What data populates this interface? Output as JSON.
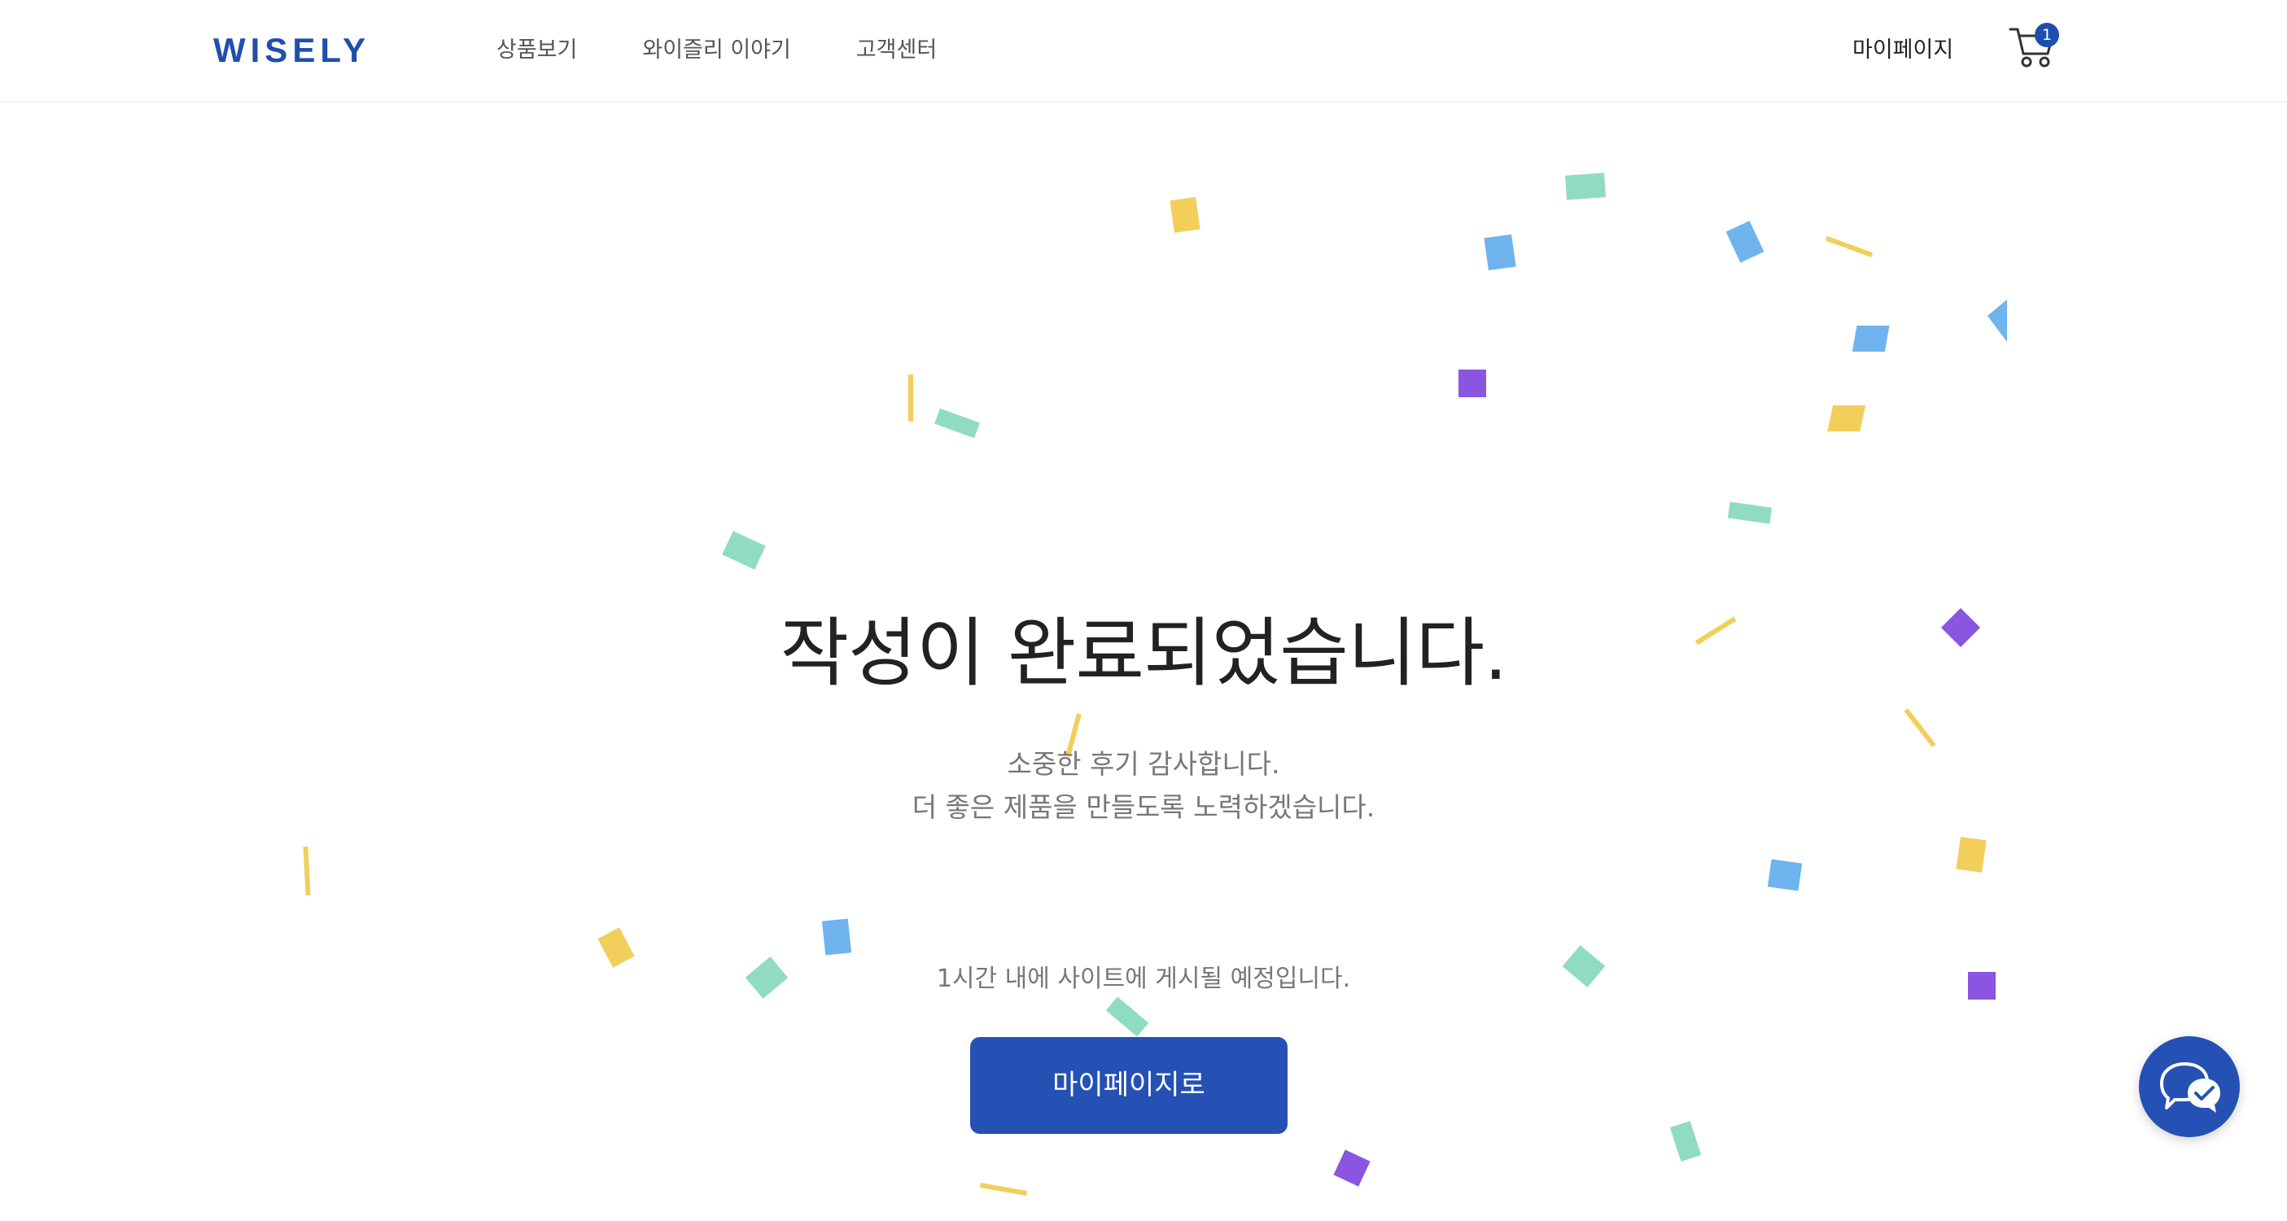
{
  "header": {
    "logo": "WISELY",
    "nav": [
      "상품보기",
      "와이즐리 이야기",
      "고객센터"
    ],
    "mypage_label": "마이페이지",
    "cart_count": "1"
  },
  "main": {
    "title": "작성이 완료되었습니다.",
    "subtitle_line1": "소중한 후기 감사합니다.",
    "subtitle_line2": "더 좋은 제품을 만들도록 노력하겠습니다.",
    "notice": "1시간 내에 사이트에 게시될 예정입니다.",
    "cta_label": "마이페이지로"
  },
  "colors": {
    "brand_blue": "#2451b3",
    "confetti_yellow": "#f2cf5b",
    "confetti_green": "#8fdcc0",
    "confetti_blue": "#6fb3ef",
    "confetti_purple": "#8a55e0"
  },
  "icons": {
    "cart": "shopping-cart-icon",
    "chat": "chat-bubble-icon"
  }
}
